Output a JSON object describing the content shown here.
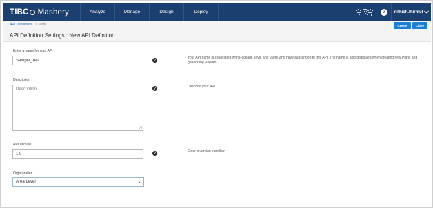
{
  "app": {
    "logo_tibco": "TIBC",
    "logo_name": "Mashery"
  },
  "nav": {
    "items": [
      {
        "label": "Analyze"
      },
      {
        "label": "Manage"
      },
      {
        "label": "Design"
      },
      {
        "label": "Deploy"
      }
    ],
    "help_glyph": "?",
    "user_name": "nithish.thirmul",
    "user_chevron": "❯"
  },
  "breadcrumb": {
    "items": [
      {
        "label": "API Definitions"
      },
      {
        "label": "Create"
      }
    ],
    "separator": "/"
  },
  "toolbar": {
    "create_label": "Create",
    "close_label": "Close"
  },
  "page": {
    "title": "API Definition Settings : New API Definition"
  },
  "form": {
    "name": {
      "label": "Enter a name for your API",
      "value": "Sample_Test",
      "help": "Your API name is associated with Package keys, and users who have subscribed to this API. The name is also displayed when creating new Plans and generating Reports."
    },
    "description": {
      "label": "Description",
      "placeholder": "Description",
      "help": "Describe your API."
    },
    "version": {
      "label": "API Version",
      "value": "1.0",
      "help": "Enter a version identifier."
    },
    "organization": {
      "label": "Organization",
      "selected": "Area Level",
      "caret": "▼"
    },
    "help_icon_glyph": "?"
  },
  "colors": {
    "navbar": "#1b3f6e",
    "button": "#1d7fd3",
    "link": "#1b6fc2"
  }
}
